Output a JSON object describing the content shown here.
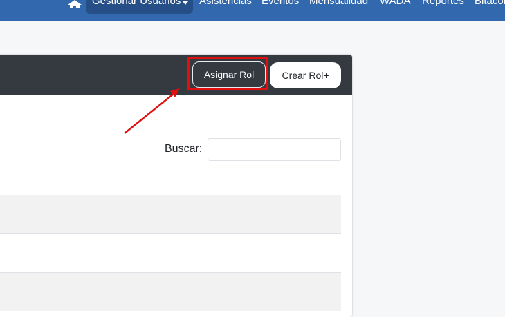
{
  "navbar": {
    "home_icon": "home-icon",
    "items": [
      {
        "label": "Gestionar Usuarios"
      },
      {
        "label": "Asistencias"
      },
      {
        "label": "Eventos"
      },
      {
        "label": "Mensualidad"
      },
      {
        "label": "WADA"
      },
      {
        "label": "Reportes"
      },
      {
        "label": "Bitacor"
      }
    ],
    "active_color": "#264f88",
    "bg_color": "#3268ad"
  },
  "card": {
    "header": {
      "assign_role_label": "Asignar Rol",
      "create_role_label": "Crear Rol+"
    },
    "search": {
      "label": "Buscar:",
      "value": "",
      "placeholder": ""
    }
  },
  "annotation": {
    "highlight_color": "#e01010"
  }
}
